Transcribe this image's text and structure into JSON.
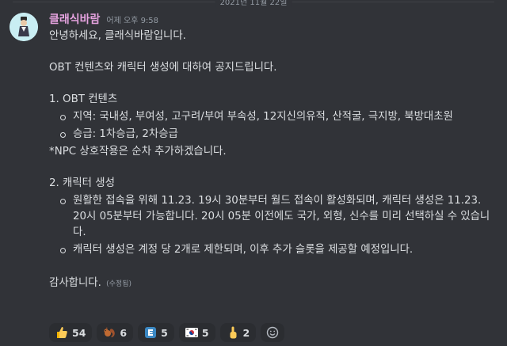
{
  "divider": {
    "date": "2021년 11월 22일"
  },
  "message": {
    "author": "클래식바람",
    "timestamp": "어제 오후 9:58",
    "greeting": "안녕하세요, 클래식바람입니다.",
    "intro": "OBT 컨텐츠와 캐릭터 생성에 대하여 공지드립니다.",
    "section1": {
      "heading": "1. OBT 컨텐츠",
      "bullets": [
        "지역: 국내성, 부여성, 고구려/부여 부속성, 12지신의유적, 산적굴, 극지방, 북방대초원",
        "승급: 1차승급, 2차승급"
      ],
      "note": "*NPC 상호작용은 순차 추가하겠습니다."
    },
    "section2": {
      "heading": "2. 캐릭터 생성",
      "bullets": [
        "원활한 접속을 위해 11.23. 19시 30분부터 월드 접속이 활성화되며, 캐릭터 생성은 11.23. 20시 05분부터 가능합니다. 20시 05분 이전에도 국가, 외형, 신수를 미리 선택하실 수 있습니다.",
        "캐릭터 생성은 계정 당 2개로 제한되며, 이후 추가 슬롯을 제공할 예정입니다."
      ]
    },
    "closing": "감사합니다.",
    "edited": "(수정됨)"
  },
  "reactions": [
    {
      "icon": "thumbs-up-icon",
      "count": "54"
    },
    {
      "icon": "squirrel-icon",
      "count": "6"
    },
    {
      "icon": "letter-e-icon",
      "count": "5"
    },
    {
      "icon": "korea-flag-icon",
      "count": "5"
    },
    {
      "icon": "pointing-up-icon",
      "count": "2"
    }
  ],
  "colors": {
    "background": "#313338",
    "username": "#e6a3e0",
    "text": "#dbdee1"
  }
}
